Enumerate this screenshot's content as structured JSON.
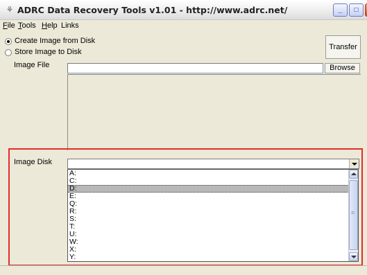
{
  "window": {
    "title": "ADRC Data Recovery Tools v1.01 - http://www.adrc.net/",
    "app_icon": "⚘",
    "controls": {
      "minimize": "_",
      "maximize": "□",
      "close": "✕"
    }
  },
  "menu": {
    "file": {
      "accel": "F",
      "rest": "ile"
    },
    "tools": {
      "accel": "T",
      "rest": "ools"
    },
    "help": {
      "accel": "H",
      "rest": "elp"
    },
    "links": "Links"
  },
  "mode": {
    "create_label": "Create Image from Disk",
    "store_label": "Store Image to Disk",
    "selected": "create"
  },
  "transfer_label": "Transfer",
  "image_file": {
    "label": "Image File",
    "value": "",
    "browse_label": "Browse"
  },
  "image_disk": {
    "label": "Image Disk",
    "value": "",
    "options": [
      "A:",
      "C:",
      "D:",
      "E:",
      "Q:",
      "R:",
      "S:",
      "T:",
      "U:",
      "W:",
      "X:",
      "Y:"
    ],
    "highlighted": "D:"
  }
}
